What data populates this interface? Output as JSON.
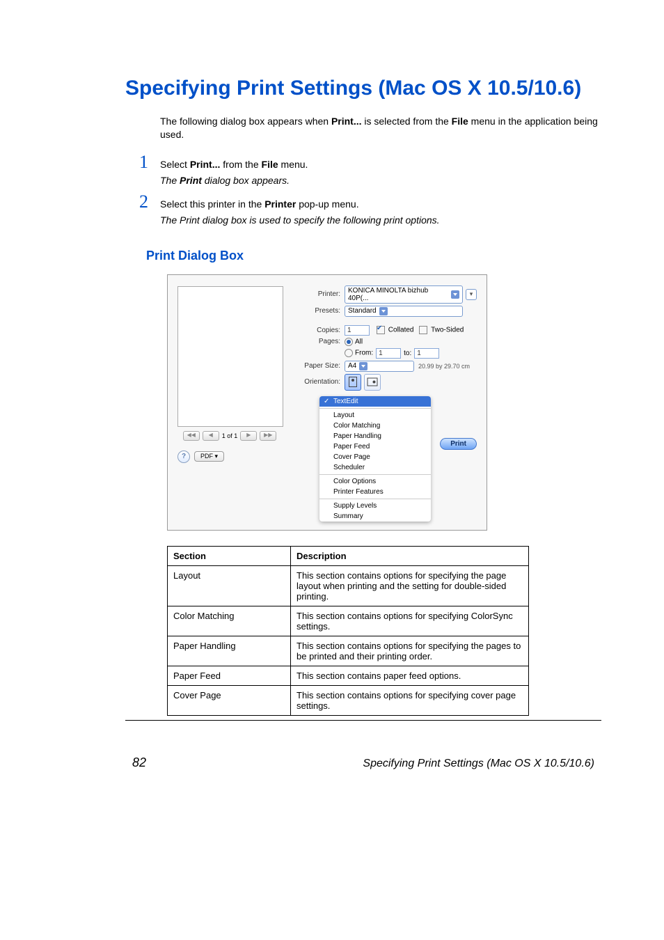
{
  "title": "Specifying Print Settings (Mac OS X 10.5/10.6)",
  "intro": {
    "pre": "The following dialog box appears when ",
    "b1": "Print...",
    "mid1": " is selected from the ",
    "b2": "File",
    "post": " menu in the application being used."
  },
  "steps": {
    "s1": {
      "num": "1",
      "pre": "Select ",
      "b1": "Print...",
      "mid": " from the ",
      "b2": "File",
      "post": " menu."
    },
    "s1note": {
      "pre": "The ",
      "b": "Print",
      "post": " dialog box appears."
    },
    "s2": {
      "num": "2",
      "pre": "Select this printer in the ",
      "b1": "Printer",
      "post": " pop-up menu."
    },
    "s2note": "The Print dialog box is used to specify the following print options."
  },
  "subheading": "Print Dialog Box",
  "dialog": {
    "labels": {
      "printer": "Printer:",
      "presets": "Presets:",
      "copies": "Copies:",
      "pages": "Pages:",
      "from": "From:",
      "to": "to:",
      "paper_size": "Paper Size:",
      "orientation": "Orientation:"
    },
    "printer_value": "KONICA MINOLTA bizhub 40P(...",
    "presets_value": "Standard",
    "copies_value": "1",
    "collated": "Collated",
    "two_sided": "Two-Sided",
    "all": "All",
    "from_value": "1",
    "to_value": "1",
    "paper_size_value": "A4",
    "paper_dim": "20.99 by 29.70 cm",
    "menu": {
      "sel": "TextEdit",
      "items1": [
        "Layout",
        "Color Matching",
        "Paper Handling",
        "Paper Feed",
        "Cover Page",
        "Scheduler"
      ],
      "items2": [
        "Color Options",
        "Printer Features"
      ],
      "items3": [
        "Supply Levels",
        "Summary"
      ]
    },
    "page_nav": "1 of 1",
    "pdf": "PDF ▾",
    "help": "?",
    "print": "Print"
  },
  "table": {
    "header": {
      "section": "Section",
      "desc": "Description"
    },
    "rows": [
      {
        "s": "Layout",
        "d": "This section contains options for specifying the page layout when printing and the setting for double-sided printing."
      },
      {
        "s": "Color Matching",
        "d": "This section contains options for specifying ColorSync settings."
      },
      {
        "s": "Paper Handling",
        "d": "This section contains options for specifying the pages to be printed and their printing order."
      },
      {
        "s": "Paper Feed",
        "d": "This section contains paper feed options."
      },
      {
        "s": "Cover Page",
        "d": "This section contains options for specifying cover page settings."
      }
    ]
  },
  "footer": {
    "page": "82",
    "text": "Specifying Print Settings (Mac OS X 10.5/10.6)"
  }
}
